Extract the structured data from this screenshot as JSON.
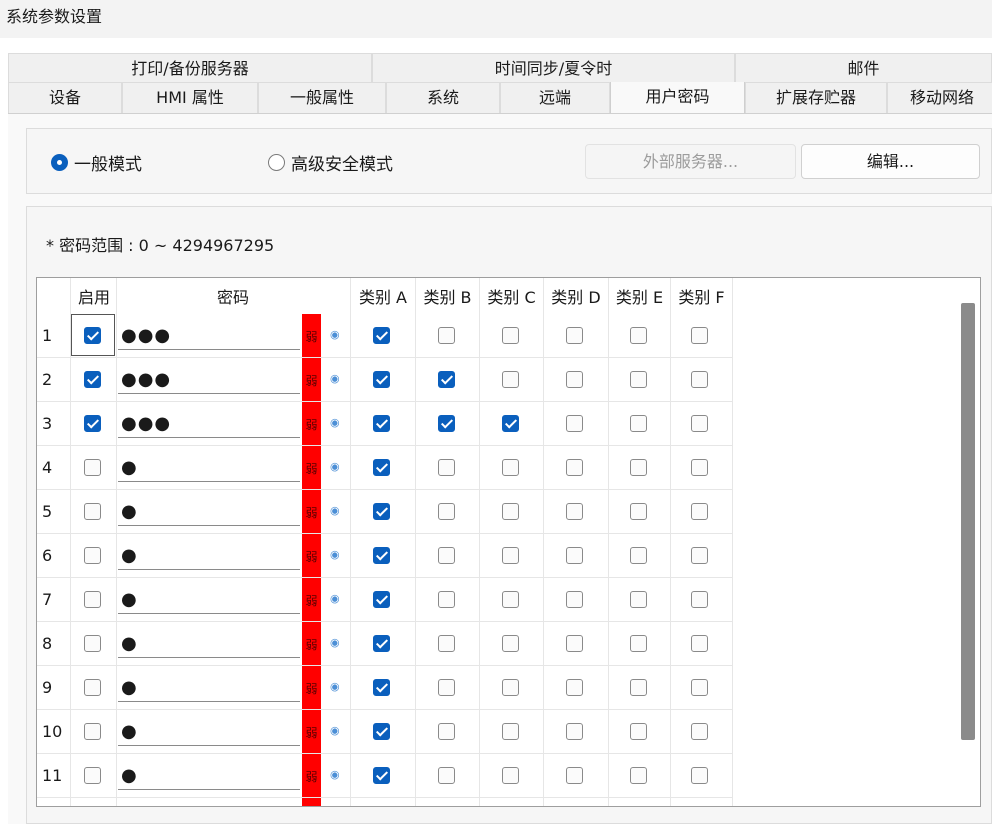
{
  "window": {
    "title": "系统参数设置"
  },
  "tabs": {
    "top": [
      "打印/备份服务器",
      "时间同步/夏令时",
      "邮件"
    ],
    "bottom": [
      "设备",
      "HMI 属性",
      "一般属性",
      "系统",
      "远端",
      "用户密码",
      "扩展存贮器",
      "移动网络"
    ],
    "active": "用户密码"
  },
  "mode": {
    "general_label": "一般模式",
    "advanced_label": "高级安全模式",
    "selected": "一般模式",
    "external_server_label": "外部服务器...",
    "edit_label": "编辑..."
  },
  "password_range": "* 密码范围 : 0 ~ 4294967295",
  "table": {
    "headers": {
      "enabled": "启用",
      "password": "密码",
      "cat_a": "类别 A",
      "cat_b": "类别 B",
      "cat_c": "类别 C",
      "cat_d": "类别 D",
      "cat_e": "类别 E",
      "cat_f": "类别 F"
    },
    "strength_label": "弱",
    "rows": [
      {
        "num": "1",
        "enabled": true,
        "password": "●●●",
        "cats": [
          true,
          false,
          false,
          false,
          false,
          false
        ]
      },
      {
        "num": "2",
        "enabled": true,
        "password": "●●●",
        "cats": [
          true,
          true,
          false,
          false,
          false,
          false
        ]
      },
      {
        "num": "3",
        "enabled": true,
        "password": "●●●",
        "cats": [
          true,
          true,
          true,
          false,
          false,
          false
        ]
      },
      {
        "num": "4",
        "enabled": false,
        "password": "●",
        "cats": [
          true,
          false,
          false,
          false,
          false,
          false
        ]
      },
      {
        "num": "5",
        "enabled": false,
        "password": "●",
        "cats": [
          true,
          false,
          false,
          false,
          false,
          false
        ]
      },
      {
        "num": "6",
        "enabled": false,
        "password": "●",
        "cats": [
          true,
          false,
          false,
          false,
          false,
          false
        ]
      },
      {
        "num": "7",
        "enabled": false,
        "password": "●",
        "cats": [
          true,
          false,
          false,
          false,
          false,
          false
        ]
      },
      {
        "num": "8",
        "enabled": false,
        "password": "●",
        "cats": [
          true,
          false,
          false,
          false,
          false,
          false
        ]
      },
      {
        "num": "9",
        "enabled": false,
        "password": "●",
        "cats": [
          true,
          false,
          false,
          false,
          false,
          false
        ]
      },
      {
        "num": "10",
        "enabled": false,
        "password": "●",
        "cats": [
          true,
          false,
          false,
          false,
          false,
          false
        ]
      },
      {
        "num": "11",
        "enabled": false,
        "password": "●",
        "cats": [
          true,
          false,
          false,
          false,
          false,
          false
        ]
      }
    ]
  },
  "colors": {
    "accent": "#0a5fbd",
    "strength_weak": "#ff0000",
    "scrollbar": "#8b8b8b"
  }
}
